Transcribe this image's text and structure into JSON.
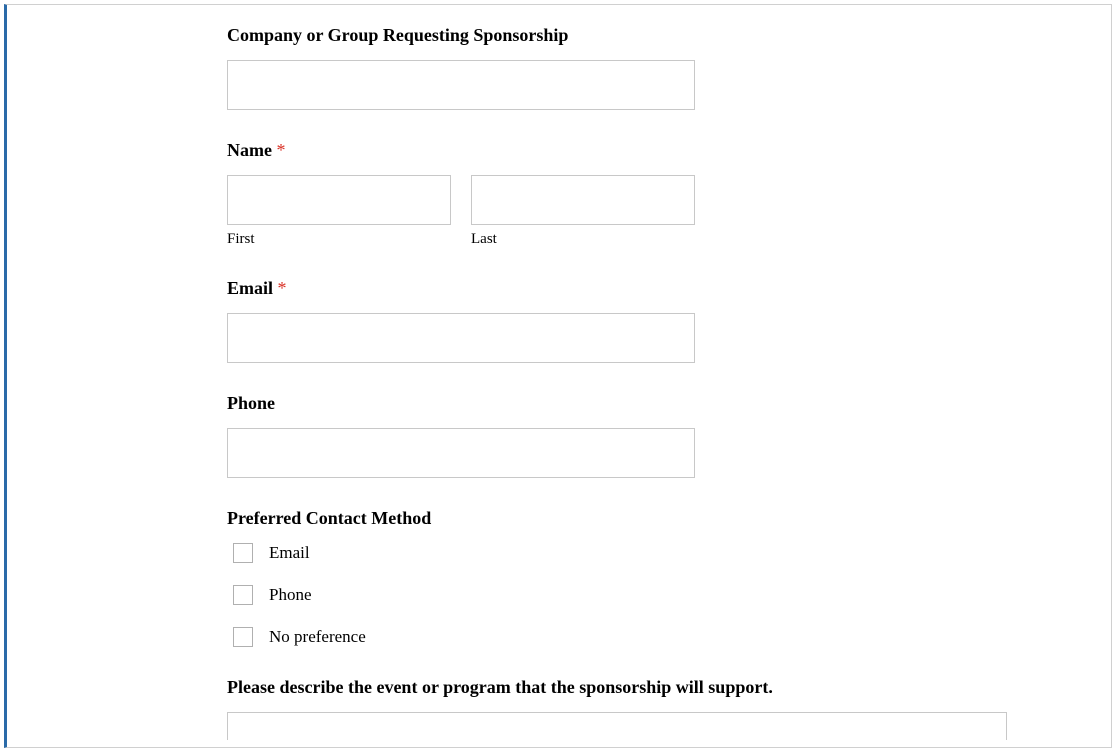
{
  "fields": {
    "company": {
      "label": "Company or Group Requesting Sponsorship"
    },
    "name": {
      "label": "Name",
      "required": "*",
      "first_sub": "First",
      "last_sub": "Last"
    },
    "email": {
      "label": "Email",
      "required": "*"
    },
    "phone": {
      "label": "Phone"
    },
    "contact_method": {
      "label": "Preferred Contact Method",
      "options": {
        "email": "Email",
        "phone": "Phone",
        "no_pref": "No preference"
      }
    },
    "describe": {
      "label": "Please describe the event or program that the sponsorship will support."
    }
  }
}
